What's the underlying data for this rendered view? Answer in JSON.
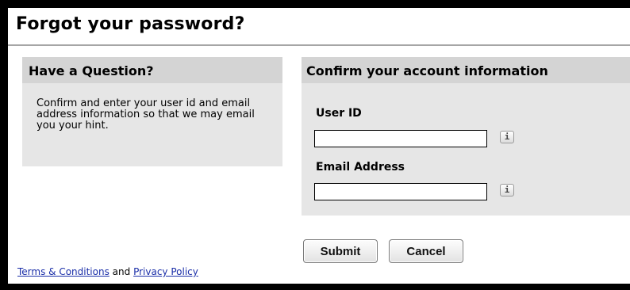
{
  "page": {
    "title": "Forgot your password?"
  },
  "help_panel": {
    "heading": "Have a Question?",
    "text": "Confirm and enter your user id and email address information so that we may email you your hint."
  },
  "account_panel": {
    "heading": "Confirm your account information",
    "user_id_label": "User ID",
    "user_id_value": "",
    "email_label": "Email Address",
    "email_value": "",
    "info_glyph": "i"
  },
  "actions": {
    "submit_label": "Submit",
    "cancel_label": "Cancel"
  },
  "footer": {
    "terms_link": "Terms & Conditions",
    "conjunction": "and",
    "privacy_link": "Privacy Policy"
  },
  "icons": {
    "info": "info-icon"
  },
  "colors": {
    "panel_bg": "#e6e6e6",
    "panel_header_bg": "#d4d4d4",
    "link": "#1a2ea8"
  }
}
